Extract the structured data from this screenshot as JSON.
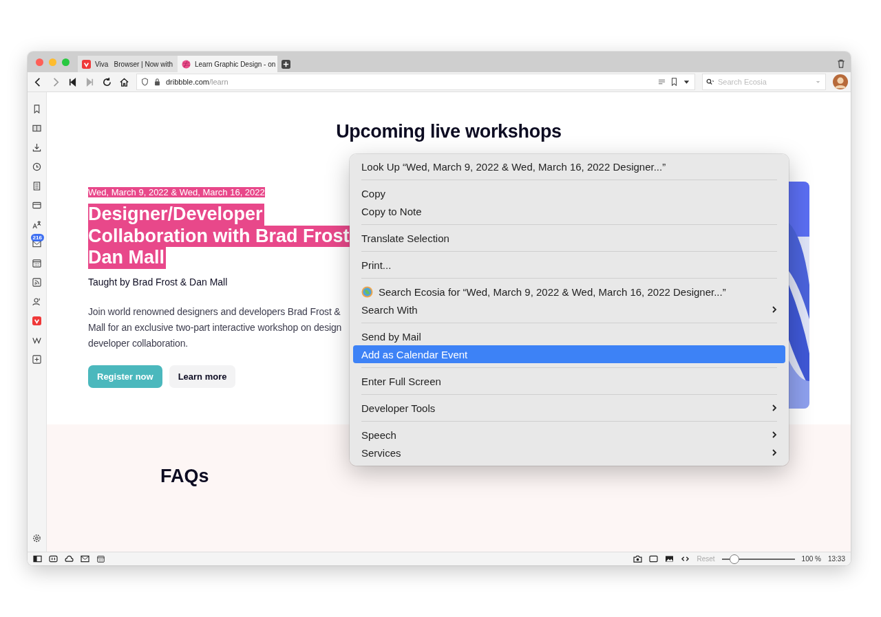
{
  "tabs": [
    {
      "label": "Viva   Browser | Now with",
      "selected": false
    },
    {
      "label": "Learn Graphic Design - on",
      "selected": true
    }
  ],
  "address": {
    "domain": "dribbble.com",
    "path": "/learn"
  },
  "search": {
    "placeholder": "Search Ecosia"
  },
  "sidebar": {
    "badge": "216"
  },
  "page": {
    "heading": "Upcoming live workshops",
    "date": {
      "text": "Wed, March 9, 2022 & Wed, March 16, 2022",
      "selected": true
    },
    "title": {
      "lines": [
        "Designer/Developer",
        "Collaboration with Brad Frost",
        "Dan Mall"
      ],
      "selected": true
    },
    "taught": "Taught by Brad Frost & Dan Mall",
    "description": [
      "Join world renowned designers and developers Brad Frost &",
      "Mall for an exclusive two-part interactive workshop on design",
      "developer collaboration."
    ],
    "buttons": [
      {
        "label": "Register now",
        "kind": "primary"
      },
      {
        "label": "Learn more",
        "kind": "secondary"
      }
    ],
    "faq_heading": "FAQs"
  },
  "context_menu": {
    "groups": [
      [
        {
          "label": "Look Up “Wed, March 9, 2022 & Wed, March 16, 2022 Designer...”",
          "kind": "plain",
          "submenu": false,
          "selected": false
        }
      ],
      [
        {
          "label": "Copy",
          "kind": "plain",
          "submenu": false,
          "selected": false
        },
        {
          "label": "Copy to Note",
          "kind": "plain",
          "submenu": false,
          "selected": false
        }
      ],
      [
        {
          "label": "Translate Selection",
          "kind": "plain",
          "submenu": false,
          "selected": false
        }
      ],
      [
        {
          "label": "Print...",
          "kind": "plain",
          "submenu": false,
          "selected": false
        }
      ],
      [
        {
          "label": "Search Ecosia for “Wed, March 9, 2022 & Wed, March 16, 2022 Designer...”",
          "kind": "search",
          "submenu": false,
          "selected": false
        },
        {
          "label": "Search With",
          "kind": "plain",
          "submenu": true,
          "selected": false
        }
      ],
      [
        {
          "label": "Send by Mail",
          "kind": "plain",
          "submenu": false,
          "selected": false
        },
        {
          "label": "Add as Calendar Event",
          "kind": "plain",
          "submenu": false,
          "selected": true
        }
      ],
      [
        {
          "label": "Enter Full Screen",
          "kind": "plain",
          "submenu": false,
          "selected": false
        }
      ],
      [
        {
          "label": "Developer Tools",
          "kind": "plain",
          "submenu": true,
          "selected": false
        }
      ],
      [
        {
          "label": "Speech",
          "kind": "plain",
          "submenu": true,
          "selected": false
        },
        {
          "label": "Services",
          "kind": "plain",
          "submenu": true,
          "selected": false
        }
      ]
    ]
  },
  "status_bar": {
    "reset": "Reset",
    "level": 0.17,
    "zoom": "100 %",
    "time": "13:33"
  }
}
